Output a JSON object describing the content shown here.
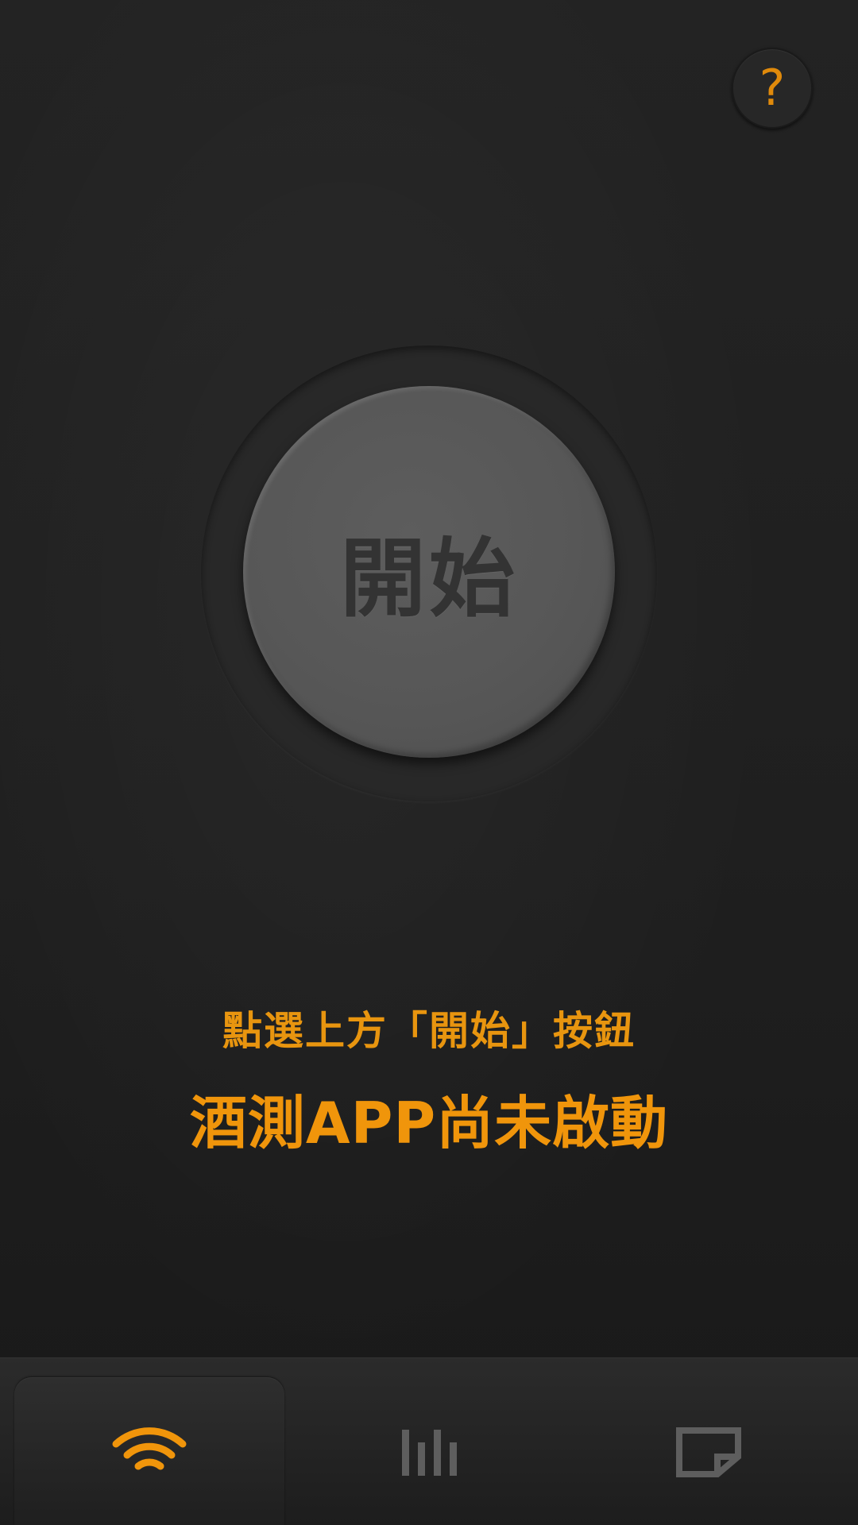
{
  "help": {
    "label": "?"
  },
  "start_button": {
    "label": "開始"
  },
  "hint_text": "點選上方「開始」按鈕",
  "status_text": "酒測APP尚未啟動",
  "tabs": [
    {
      "icon": "wifi-icon",
      "active": true
    },
    {
      "icon": "bar-chart-icon",
      "active": false
    },
    {
      "icon": "note-icon",
      "active": false
    }
  ],
  "colors": {
    "accent": "#f0950b",
    "button_gray": "#575757",
    "inactive_icon": "#5e5e5e"
  }
}
